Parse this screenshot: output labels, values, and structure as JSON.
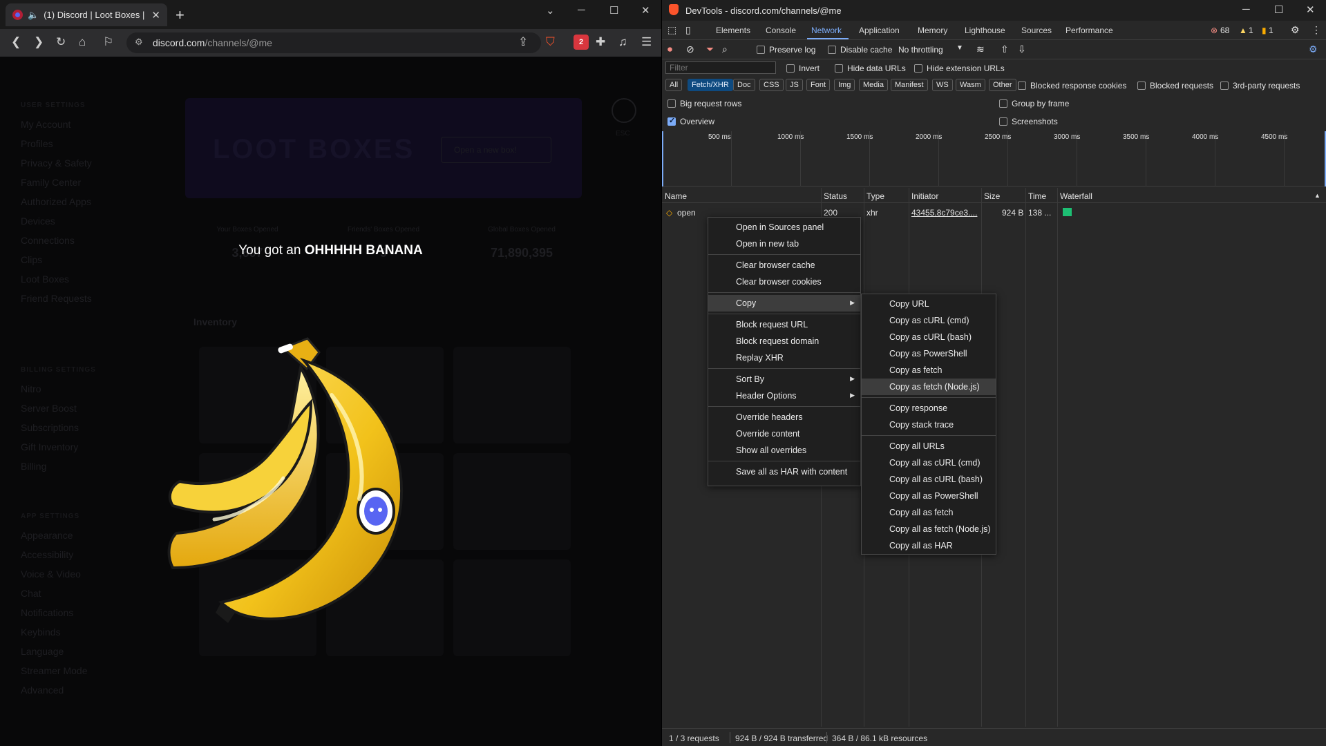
{
  "browser": {
    "tab_title": "(1) Discord | Loot Boxes | Use",
    "url_host": "discord.com",
    "url_path": "/channels/@me",
    "extension_badge": "2"
  },
  "discord": {
    "sidebar_heading_user": "USER SETTINGS",
    "sidebar_items_user": [
      "My Account",
      "Profiles",
      "Privacy & Safety",
      "Family Center",
      "Authorized Apps",
      "Devices",
      "Connections",
      "Clips",
      "Loot Boxes",
      "Friend Requests"
    ],
    "sidebar_heading_billing": "BILLING SETTINGS",
    "sidebar_items_billing": [
      "Nitro",
      "Server Boost",
      "Subscriptions",
      "Gift Inventory",
      "Billing"
    ],
    "sidebar_heading_app": "APP SETTINGS",
    "sidebar_items_app": [
      "Appearance",
      "Accessibility",
      "Voice & Video",
      "Chat",
      "Notifications",
      "Keybinds",
      "Language",
      "Streamer Mode",
      "Advanced"
    ],
    "banner_title": "LOOT BOXES",
    "open_button": "Open a new box!",
    "stats": [
      {
        "label": "Your Boxes Opened",
        "value": "3,607"
      },
      {
        "label": "Friends' Boxes Opened",
        "value": "9"
      },
      {
        "label": "Global Boxes Opened",
        "value": "71,890,395"
      }
    ],
    "inventory_label": "Inventory",
    "esc_label": "ESC",
    "popup_prefix": "You got an",
    "popup_item": "OHHHHH BANANA"
  },
  "devtools": {
    "title": "DevTools - discord.com/channels/@me",
    "tabs": [
      "Elements",
      "Console",
      "Network",
      "Application",
      "Memory",
      "Lighthouse",
      "Sources",
      "Performance"
    ],
    "active_tab": "Network",
    "error_count": "68",
    "warning_count": "1",
    "issue_count": "1",
    "preserve_log": "Preserve log",
    "disable_cache": "Disable cache",
    "throttling": "No throttling",
    "filter_placeholder": "Filter",
    "invert": "Invert",
    "hide_data_urls": "Hide data URLs",
    "hide_extension_urls": "Hide extension URLs",
    "resource_types": [
      "All",
      "Fetch/XHR",
      "Doc",
      "CSS",
      "JS",
      "Font",
      "Img",
      "Media",
      "Manifest",
      "WS",
      "Wasm",
      "Other"
    ],
    "active_resource_type": "Fetch/XHR",
    "blocked_response_cookies": "Blocked response cookies",
    "blocked_requests": "Blocked requests",
    "third_party": "3rd-party requests",
    "big_request_rows": "Big request rows",
    "group_by_frame": "Group by frame",
    "overview": "Overview",
    "screenshots": "Screenshots",
    "timeline_ticks": [
      "500 ms",
      "1000 ms",
      "1500 ms",
      "2000 ms",
      "2500 ms",
      "3000 ms",
      "3500 ms",
      "4000 ms",
      "4500 ms"
    ],
    "columns": [
      "Name",
      "Status",
      "Type",
      "Initiator",
      "Size",
      "Time",
      "Waterfall"
    ],
    "rows": [
      {
        "name": "open",
        "status": "200",
        "type": "xhr",
        "initiator": "43455.8c79ce3....",
        "size": "924 B",
        "time": "138 ..."
      }
    ],
    "status_bar": [
      "1 / 3 requests",
      "924 B / 924 B transferred",
      "364 B / 86.1 kB resources"
    ]
  },
  "context_menu": {
    "items": [
      "Open in Sources panel",
      "Open in new tab",
      "Clear browser cache",
      "Clear browser cookies",
      "Copy",
      "Block request URL",
      "Block request domain",
      "Replay XHR",
      "Sort By",
      "Header Options",
      "Override headers",
      "Override content",
      "Show all overrides",
      "Save all as HAR with content"
    ]
  },
  "copy_submenu": {
    "items": [
      "Copy URL",
      "Copy as cURL (cmd)",
      "Copy as cURL (bash)",
      "Copy as PowerShell",
      "Copy as fetch",
      "Copy as fetch (Node.js)",
      "Copy response",
      "Copy stack trace",
      "Copy all URLs",
      "Copy all as cURL (cmd)",
      "Copy all as cURL (bash)",
      "Copy all as PowerShell",
      "Copy all as fetch",
      "Copy all as fetch (Node.js)",
      "Copy all as HAR"
    ],
    "highlighted": "Copy as fetch (Node.js)"
  },
  "colors": {
    "accent": "#7cacf8",
    "banana": "#f2c21b",
    "discord_blurple": "#5865f2"
  }
}
